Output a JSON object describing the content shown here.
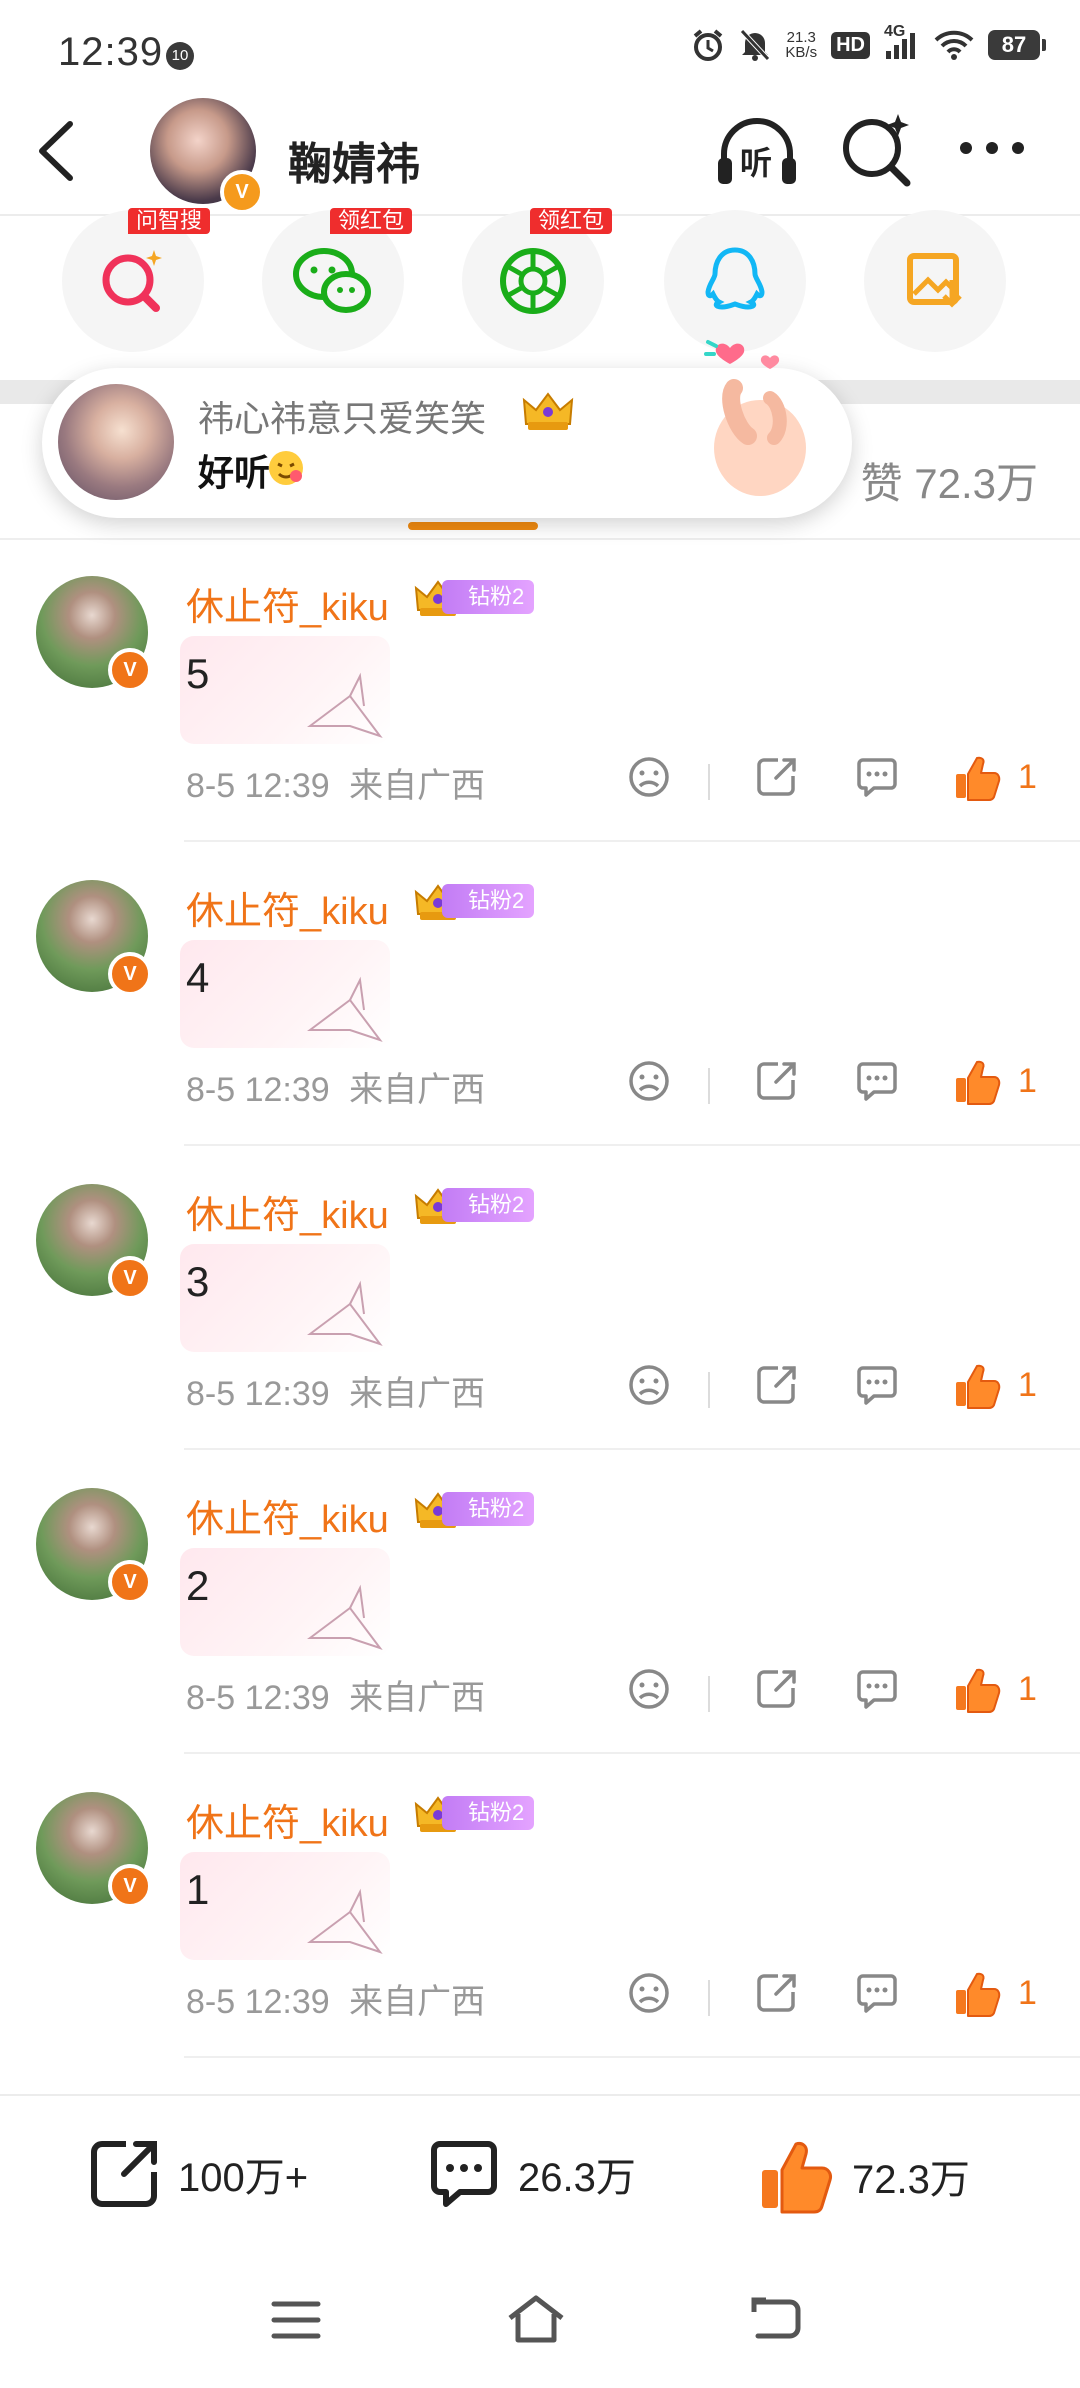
{
  "status_bar": {
    "time": "12:39",
    "notif_badge": "10",
    "speed_value": "21.3",
    "speed_unit": "KB/s",
    "hd": "HD",
    "network": "4G",
    "battery": "87"
  },
  "header": {
    "title": "鞠婧祎",
    "listen_label": "听",
    "verified_badge": "V"
  },
  "share_row": {
    "items": [
      {
        "icon": "ask-search-icon",
        "tag": "问智搜"
      },
      {
        "icon": "wechat-icon",
        "tag": "领红包"
      },
      {
        "icon": "moments-icon",
        "tag": "领红包"
      },
      {
        "icon": "qq-icon",
        "tag": ""
      },
      {
        "icon": "save-image-icon",
        "tag": ""
      }
    ]
  },
  "toast": {
    "name": "祎心祎意只爱笑笑",
    "message": "好听"
  },
  "likes_label": "赞 72.3万",
  "comments": [
    {
      "name": "休止符_kiku",
      "fan_badge": "钻粉2",
      "text": "5",
      "time": "8-5 12:39",
      "location": "来自广西",
      "likes": "1"
    },
    {
      "name": "休止符_kiku",
      "fan_badge": "钻粉2",
      "text": "4",
      "time": "8-5 12:39",
      "location": "来自广西",
      "likes": "1"
    },
    {
      "name": "休止符_kiku",
      "fan_badge": "钻粉2",
      "text": "3",
      "time": "8-5 12:39",
      "location": "来自广西",
      "likes": "1"
    },
    {
      "name": "休止符_kiku",
      "fan_badge": "钻粉2",
      "text": "2",
      "time": "8-5 12:39",
      "location": "来自广西",
      "likes": "1"
    },
    {
      "name": "休止符_kiku",
      "fan_badge": "钻粉2",
      "text": "1",
      "time": "8-5 12:39",
      "location": "来自广西",
      "likes": "1"
    }
  ],
  "bottom_bar": {
    "repost_count": "100万+",
    "comment_count": "26.3万",
    "like_count": "72.3万"
  },
  "colors": {
    "accent_orange": "#f07418",
    "like_orange": "#f07418",
    "tag_red": "#ef2d2d",
    "fan_purple": "#c27cf5"
  }
}
